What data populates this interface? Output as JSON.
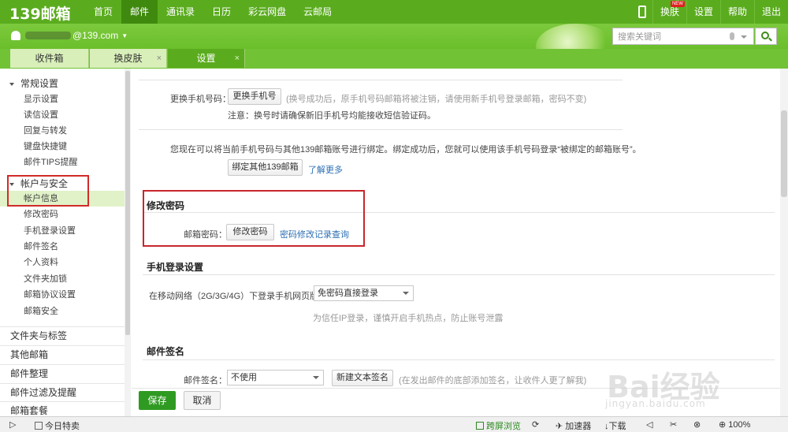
{
  "topbar": {
    "logo": "139邮箱",
    "nav": [
      "首页",
      "邮件",
      "通讯录",
      "日历",
      "彩云网盘",
      "云邮局"
    ],
    "active_nav_index": 1,
    "right": {
      "skin": "换肤",
      "new_badge": "NEW",
      "settings": "设置",
      "help": "帮助",
      "logout": "退出"
    }
  },
  "account": {
    "email_suffix": "@139.com"
  },
  "search": {
    "placeholder": "搜索关键词"
  },
  "tabs": [
    {
      "label": "收件箱",
      "closable": false
    },
    {
      "label": "换皮肤",
      "closable": true
    },
    {
      "label": "设置",
      "closable": true,
      "active": true
    }
  ],
  "sidebar": {
    "group_general": "常规设置",
    "general_items": [
      "显示设置",
      "读信设置",
      "回复与转发",
      "键盘快捷键",
      "邮件TIPS提醒"
    ],
    "group_account": "帐户与安全",
    "account_items": [
      "帐户信息",
      "修改密码",
      "手机登录设置",
      "邮件签名",
      "个人资料",
      "文件夹加锁",
      "邮箱协议设置",
      "邮箱安全"
    ],
    "active_item": "帐户信息",
    "sections": [
      "文件夹与标签",
      "其他邮箱",
      "邮件整理",
      "邮件过滤及提醒",
      "邮箱套餐"
    ]
  },
  "main": {
    "change_phone": {
      "label": "更换手机号码：",
      "button": "更换手机号",
      "hint": "(换号成功后，原手机号码邮箱将被注销，请使用新手机号登录邮箱，密码不变)",
      "note": "注意：换号时请确保新旧手机号均能接收短信验证码。"
    },
    "bind": {
      "text": "您现在可以将当前手机号码与其他139邮箱账号进行绑定。绑定成功后，您就可以使用该手机号码登录“被绑定的邮箱账号”。",
      "button": "绑定其他139邮箱",
      "learn_more": "了解更多"
    },
    "change_password": {
      "title": "修改密码",
      "label": "邮箱密码：",
      "button": "修改密码",
      "history_link": "密码修改记录查询"
    },
    "mobile_login": {
      "title": "手机登录设置",
      "label": "在移动网络（2G/3G/4G）下登录手机网页版时：",
      "selected": "免密码直接登录",
      "hint": "为信任IP登录，谨慎开启手机热点，防止账号泄露"
    },
    "signature": {
      "title": "邮件签名",
      "label": "邮件签名：",
      "selected": "不使用",
      "new_button": "新建文本签名",
      "hint": "(在发出邮件的底部添加签名，让收件人更了解我)"
    }
  },
  "actions": {
    "save": "保存",
    "cancel": "取消"
  },
  "watermark": {
    "main": "Bai经验",
    "sub": "jingyan.baidu.com"
  },
  "statusbar": {
    "today": "今日特卖",
    "split_view": "跨屏浏览",
    "accelerator": "加速器",
    "download": "下载",
    "zoom": "100%"
  }
}
